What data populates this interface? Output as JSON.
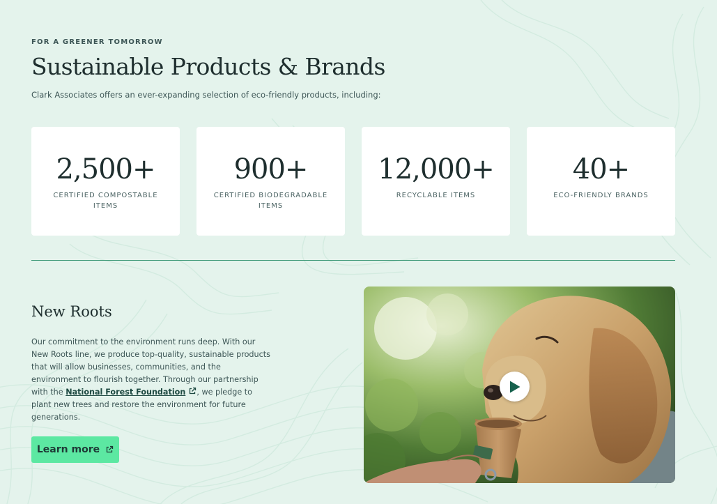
{
  "header": {
    "eyebrow": "FOR A GREENER TOMORROW",
    "title": "Sustainable Products & Brands",
    "subtitle": "Clark Associates offers an ever-expanding selection of eco-friendly products, including:"
  },
  "stats": [
    {
      "value": "2,500+",
      "label": "CERTIFIED COMPOSTABLE ITEMS"
    },
    {
      "value": "900+",
      "label": "CERTIFIED BIODEGRADABLE ITEMS"
    },
    {
      "value": "12,000+",
      "label": "RECYCLABLE ITEMS"
    },
    {
      "value": "40+",
      "label": "ECO-FRIENDLY BRANDS"
    }
  ],
  "new_roots": {
    "title": "New Roots",
    "body_before": "Our commitment to the environment runs deep. With our New Roots line, we produce top-quality, sustainable products that will allow businesses, communities, and the environment to flourish together. Through our partnership with the ",
    "link_text": "National Forest Foundation",
    "body_after": ", we pledge to plant new trees and restore the environment for future generations.",
    "button_label": "Learn more"
  },
  "video": {
    "play_icon": "play-icon",
    "thumbnail": "golden retriever drinking from a paper cup"
  },
  "colors": {
    "background": "#e4f3ec",
    "accent_button": "#5ce8a2",
    "divider": "#3e9a78",
    "heading": "#1e2e2e",
    "play_triangle": "#16614d"
  }
}
